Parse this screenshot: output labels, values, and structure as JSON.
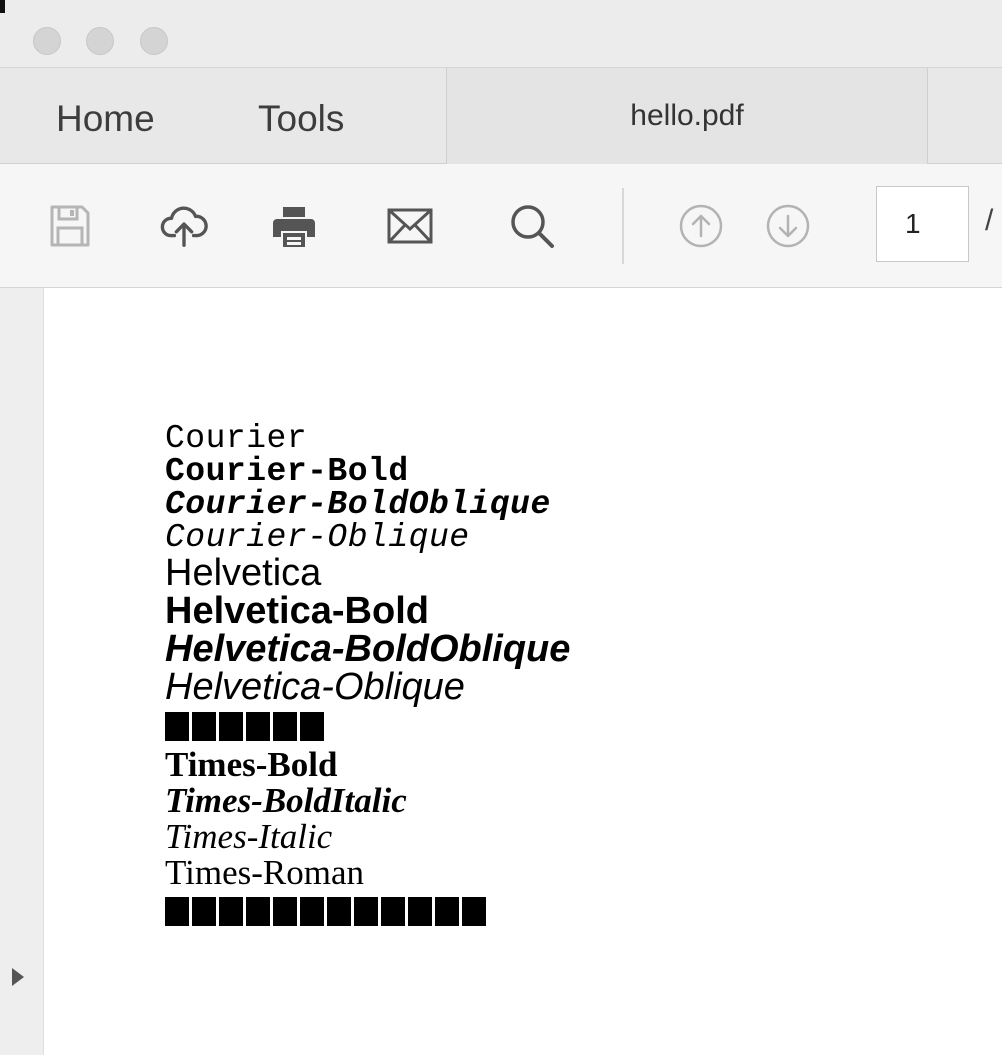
{
  "window": {
    "controls": [
      "close",
      "minimize",
      "zoom"
    ]
  },
  "tabs": {
    "home": "Home",
    "tools": "Tools",
    "document": "hello.pdf"
  },
  "toolbar": {
    "icons": [
      "save-icon",
      "upload-cloud-icon",
      "print-icon",
      "email-icon",
      "search-icon",
      "page-up-icon",
      "page-down-icon"
    ],
    "page_number": "1",
    "page_separator": "/"
  },
  "document": {
    "lines": [
      "Courier",
      "Courier-Bold",
      "Courier-BoldOblique",
      "Courier-Oblique",
      "Helvetica",
      "Helvetica-Bold",
      "Helvetica-BoldOblique",
      "Helvetica-Oblique",
      "Times-Bold",
      "Times-BoldItalic",
      "Times-Italic",
      "Times-Roman"
    ],
    "missing_glyph_runs": [
      {
        "after_line": "Helvetica-Oblique",
        "count": 6
      },
      {
        "after_line": "Times-Roman",
        "count": 12
      }
    ]
  }
}
